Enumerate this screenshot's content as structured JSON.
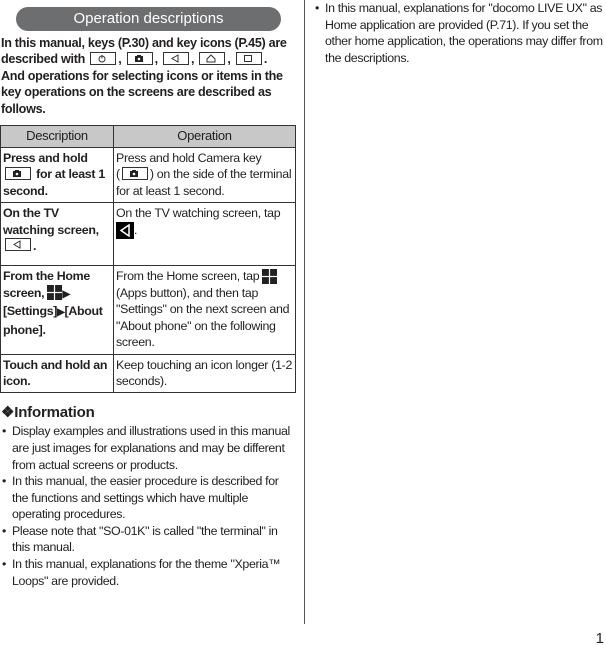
{
  "section_title": "Operation descriptions",
  "intro": {
    "line1": "In this manual, keys (P.30) and key icons (P.45) are",
    "line2_prefix": "described with",
    "key_icons": [
      "power-key-icon",
      "camera-key-icon",
      "back-key-icon",
      "home-key-icon",
      "recent-apps-key-icon"
    ],
    "line3": "And operations for selecting icons or items in the key operations on the screens are described as follows."
  },
  "table": {
    "headers": [
      "Description",
      "Operation"
    ],
    "rows": [
      {
        "desc_pre": "Press and hold",
        "desc_post": "for at least 1 second.",
        "op_pre": "Press and hold Camera key",
        "op_mid": "(",
        "op_post": ") on the side of the terminal for at least 1 second."
      },
      {
        "desc_pre": "On the TV watching screen,",
        "desc_post": ".",
        "op_pre": "On the TV watching screen, tap",
        "op_post": "."
      },
      {
        "desc_pre": "From the Home screen,",
        "desc_mid": "[Settings]",
        "desc_post": "[About phone].",
        "op_pre": "From the Home screen, tap",
        "op_post": "(Apps button), and then tap \"Settings\" on the next screen and \"About phone\" on the following screen."
      },
      {
        "desc": "Touch and hold an icon.",
        "op": "Keep touching an icon longer (1-2 seconds)."
      }
    ]
  },
  "information": {
    "heading": "Information",
    "heading_icon": "diamond-ornament-icon",
    "bullets": [
      "Display examples and illustrations used in this manual are just images for explanations and may be different from actual screens or products.",
      "In this manual, the easier procedure is described for the functions and settings which have multiple operating procedures.",
      "Please note that \"SO-01K\" is called \"the terminal\" in this manual.",
      "In this manual, explanations for the theme \"Xperia™ Loops\" are provided."
    ]
  },
  "right_column": {
    "bullets": [
      "In this manual, explanations for \"docomo LIVE UX\" as Home application are provided (P.71). If you set the other home application, the operations may differ from the descriptions."
    ]
  },
  "page_number": "1"
}
